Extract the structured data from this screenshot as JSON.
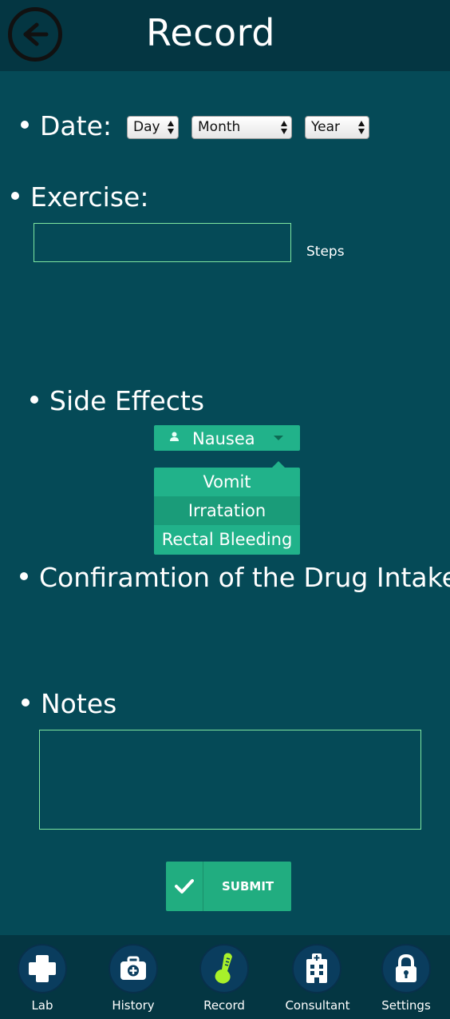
{
  "header": {
    "title": "Record",
    "back_icon": "back-arrow-icon"
  },
  "date": {
    "label": "Date:",
    "day": "Day",
    "month": "Month",
    "year": "Year"
  },
  "exercise": {
    "label": "Exercise:",
    "unit": "Steps",
    "value": ""
  },
  "side_effects": {
    "label": "Side Effects",
    "selected": "Nausea",
    "options": [
      "Vomit",
      "Irratation",
      "Rectal Bleeding"
    ]
  },
  "drug_intake": {
    "label": "Confiramtion of the Drug Intake"
  },
  "notes": {
    "label": "Notes",
    "value": ""
  },
  "submit": {
    "label": "SUBMIT"
  },
  "nav": [
    {
      "label": "Lab",
      "icon": "cross-icon"
    },
    {
      "label": "History",
      "icon": "medical-kit-icon"
    },
    {
      "label": "Record",
      "icon": "thermometer-icon"
    },
    {
      "label": "Consultant",
      "icon": "hospital-icon"
    },
    {
      "label": "Settings",
      "icon": "lock-icon"
    }
  ],
  "colors": {
    "background": "#054a57",
    "header": "#043642",
    "accent": "#21b28a",
    "record_icon": "#a8f02a"
  }
}
